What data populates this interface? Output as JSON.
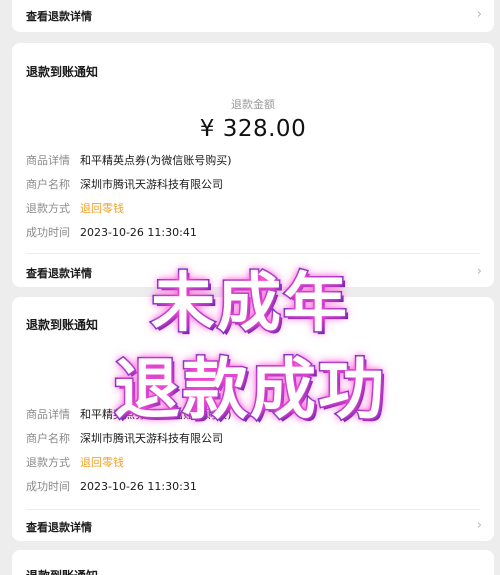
{
  "card0": {
    "details_link": "查看退款详情",
    "chevron": "›"
  },
  "card1": {
    "title": "退款到账通知",
    "amount_label": "退款金额",
    "amount": "¥ 328.00",
    "rows": [
      {
        "label": "商品详情",
        "value": "和平精英点券(为微信账号购买)"
      },
      {
        "label": "商户名称",
        "value": "深圳市腾讯天游科技有限公司"
      },
      {
        "label": "退款方式",
        "value": "退回零钱"
      },
      {
        "label": "成功时间",
        "value": "2023-10-26 11:30:41"
      }
    ],
    "details_link": "查看退款详情",
    "chevron": "›"
  },
  "card2": {
    "title": "退款到账通知",
    "rows": [
      {
        "label": "商品详情",
        "value": "和平精英点券(为微信账号购买)"
      },
      {
        "label": "商户名称",
        "value": "深圳市腾讯天游科技有限公司"
      },
      {
        "label": "退款方式",
        "value": "退回零钱"
      },
      {
        "label": "成功时间",
        "value": "2023-10-26 11:30:31"
      }
    ],
    "details_link": "查看退款详情",
    "chevron": "›"
  },
  "card3": {
    "title": "退款到账通知"
  },
  "overlay": {
    "line1": "未成年",
    "line2": "退款成功"
  },
  "colors": {
    "accent_orange": "#f0a32a",
    "overlay_stroke": "#3a2db8",
    "overlay_glow": "#ff4fd8"
  }
}
